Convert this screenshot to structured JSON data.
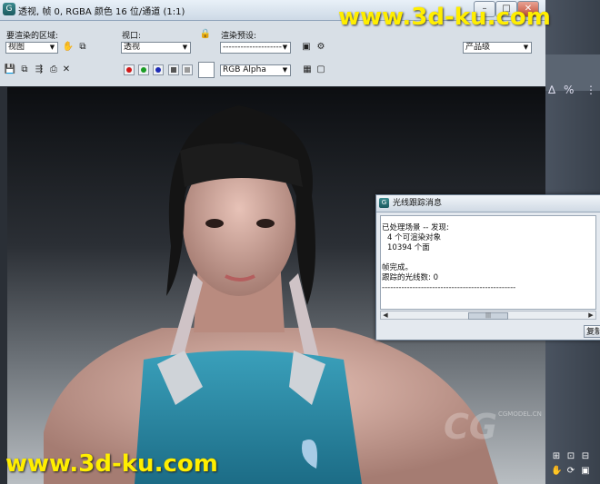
{
  "window": {
    "title": "透视, 帧 0, RGBA 颜色 16 位/通道 (1:1)",
    "app_icon": "G"
  },
  "window_buttons": {
    "minimize": "–",
    "maximize": "□",
    "close": "✕"
  },
  "watermark_top": "www.3d-ku.com",
  "watermark_bottom": "www.3d-ku.com",
  "toolbar": {
    "area_label": "要渲染的区域:",
    "area_value": "视图",
    "viewport_label": "视口:",
    "viewport_value": "透视",
    "preset_label": "渲染预设:",
    "preset_value": "--------------------",
    "quality_value": "产品级",
    "channel_value": "RGB Alpha"
  },
  "icons": {
    "region_hand": "hand-icon",
    "region_copy": "copy-icon",
    "lock": "lock-icon",
    "save": "save-icon",
    "copy_image": "copy-image-icon",
    "clone": "clone-icon",
    "print": "print-icon",
    "clear": "clear-icon",
    "red_channel": "red-channel-icon",
    "green_channel": "green-channel-icon",
    "blue_channel": "blue-channel-icon",
    "alpha_channel": "alpha-channel-icon",
    "mono": "monochrome-icon",
    "display_alpha": "display-alpha-icon"
  },
  "colors": {
    "red": "#d01818",
    "green": "#1a9c24",
    "blue": "#1d2bb5",
    "watermark": "#ffee00"
  },
  "message_window": {
    "title": "光线跟踪消息",
    "lines": [
      "已处理场景 -- 发现:",
      "  4 个可渲染对象",
      "  10394 个面",
      "",
      "帧完成。",
      "跟踪的光线数: 0"
    ],
    "divider": "------------------------------------------------",
    "button_label": "复制"
  },
  "cg_watermark": {
    "logo": "CG",
    "sub": "CGMODEL.CN"
  },
  "right_panel_symbols": [
    "∆",
    "%",
    "⋮"
  ]
}
